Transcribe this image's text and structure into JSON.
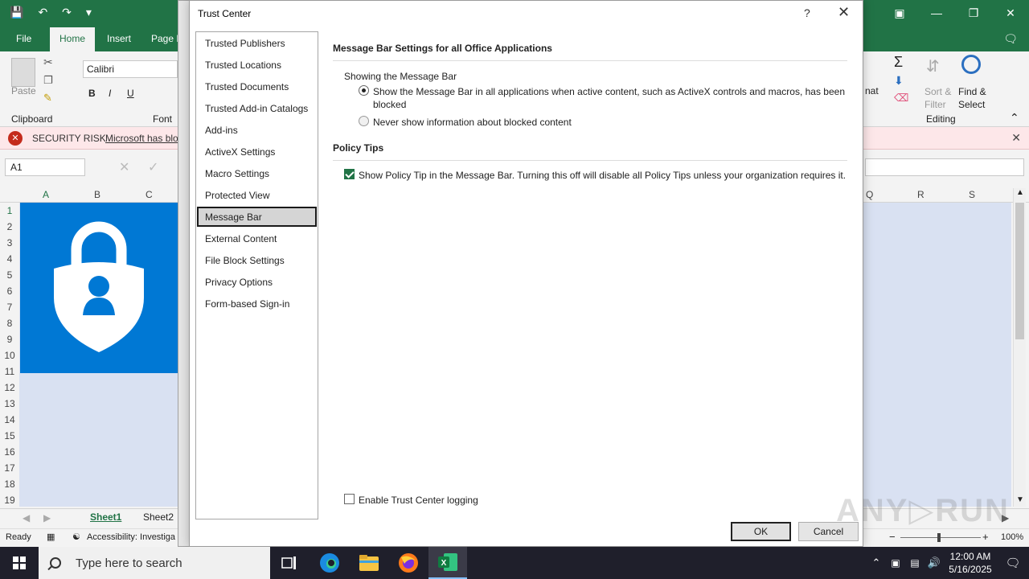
{
  "excel": {
    "tabs": [
      "File",
      "Home",
      "Insert",
      "Page L"
    ],
    "font_name": "Calibri",
    "groups": {
      "clipboard": "Clipboard",
      "font": "Font",
      "editing": "Editing"
    },
    "paste_label": "Paste",
    "sort_filter": "Sort &\nFilter",
    "find_select": "Find &\nSelect",
    "format_partial": "nat",
    "security_risk": "SECURITY RISK",
    "security_msg": "Microsoft has blo",
    "name_box": "A1",
    "columns": [
      "A",
      "B",
      "C",
      "Q",
      "R",
      "S"
    ],
    "rows": [
      "1",
      "2",
      "3",
      "4",
      "5",
      "6",
      "7",
      "8",
      "9",
      "10",
      "11",
      "12",
      "13",
      "14",
      "15",
      "16",
      "17",
      "18",
      "19"
    ],
    "sheets": [
      "Sheet1",
      "Sheet2"
    ],
    "status_ready": "Ready",
    "accessibility": "Accessibility: Investiga",
    "zoom": "100%"
  },
  "dialog": {
    "title": "Trust Center",
    "help": "?",
    "nav": [
      "Trusted Publishers",
      "Trusted Locations",
      "Trusted Documents",
      "Trusted Add-in Catalogs",
      "Add-ins",
      "ActiveX Settings",
      "Macro Settings",
      "Protected View",
      "Message Bar",
      "External Content",
      "File Block Settings",
      "Privacy Options",
      "Form-based Sign-in"
    ],
    "selected_nav": "Message Bar",
    "section1_title": "Message Bar Settings for all Office Applications",
    "showing_label": "Showing the Message Bar",
    "radio1_line1": "Show the Message Bar in all applications when active content, such as ActiveX controls and macros, has been",
    "radio1_line2": "blocked",
    "radio2": "Never show information about blocked content",
    "section2_title": "Policy Tips",
    "policy_check": "Show Policy Tip in the Message Bar. Turning this off will disable all Policy Tips unless your organization requires it.",
    "logging_check": "Enable Trust Center logging",
    "ok": "OK",
    "cancel": "Cancel"
  },
  "taskbar": {
    "search_placeholder": "Type here to search",
    "time": "12:00 AM",
    "date": "5/16/2025"
  },
  "colors": {
    "excel_green": "#217346",
    "logo_blue": "#0078d4",
    "sheet_tint": "#d9e1f2"
  }
}
